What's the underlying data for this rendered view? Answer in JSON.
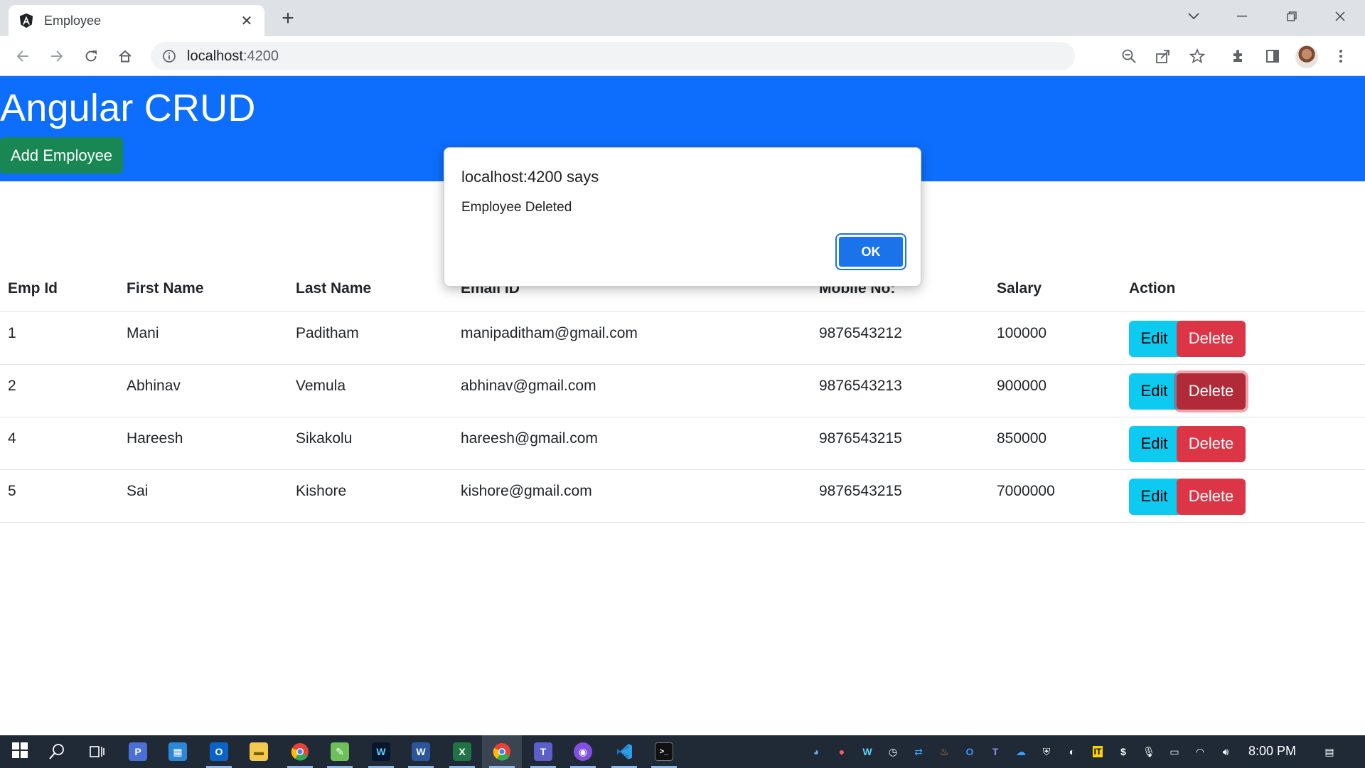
{
  "browser": {
    "tab_title": "Employee",
    "url_host": "localhost",
    "url_port": ":4200"
  },
  "app": {
    "title": "Angular CRUD",
    "add_button": "Add Employee"
  },
  "table": {
    "headers": [
      "Emp Id",
      "First Name",
      "Last Name",
      "Email ID",
      "Mobile No:",
      "Salary",
      "Action"
    ],
    "rows": [
      {
        "id": "1",
        "first": "Mani",
        "last": "Paditham",
        "email": "manipaditham@gmail.com",
        "mobile": "9876543212",
        "salary": "100000"
      },
      {
        "id": "2",
        "first": "Abhinav",
        "last": "Vemula",
        "email": "abhinav@gmail.com",
        "mobile": "9876543213",
        "salary": "900000"
      },
      {
        "id": "4",
        "first": "Hareesh",
        "last": "Sikakolu",
        "email": "hareesh@gmail.com",
        "mobile": "9876543215",
        "salary": "850000"
      },
      {
        "id": "5",
        "first": "Sai",
        "last": "Kishore",
        "email": "kishore@gmail.com",
        "mobile": "9876543215",
        "salary": "7000000"
      }
    ],
    "edit_label": "Edit",
    "delete_label": "Delete"
  },
  "dialog": {
    "title": "localhost:4200 says",
    "message": "Employee Deleted",
    "ok_label": "OK"
  },
  "taskbar": {
    "time": "8:00 PM"
  },
  "colors": {
    "header_bg": "#0d6efd",
    "add_button": "#198754",
    "edit_button": "#0dcaf0",
    "delete_button": "#dc3545",
    "dialog_ok": "#1a73e8"
  }
}
